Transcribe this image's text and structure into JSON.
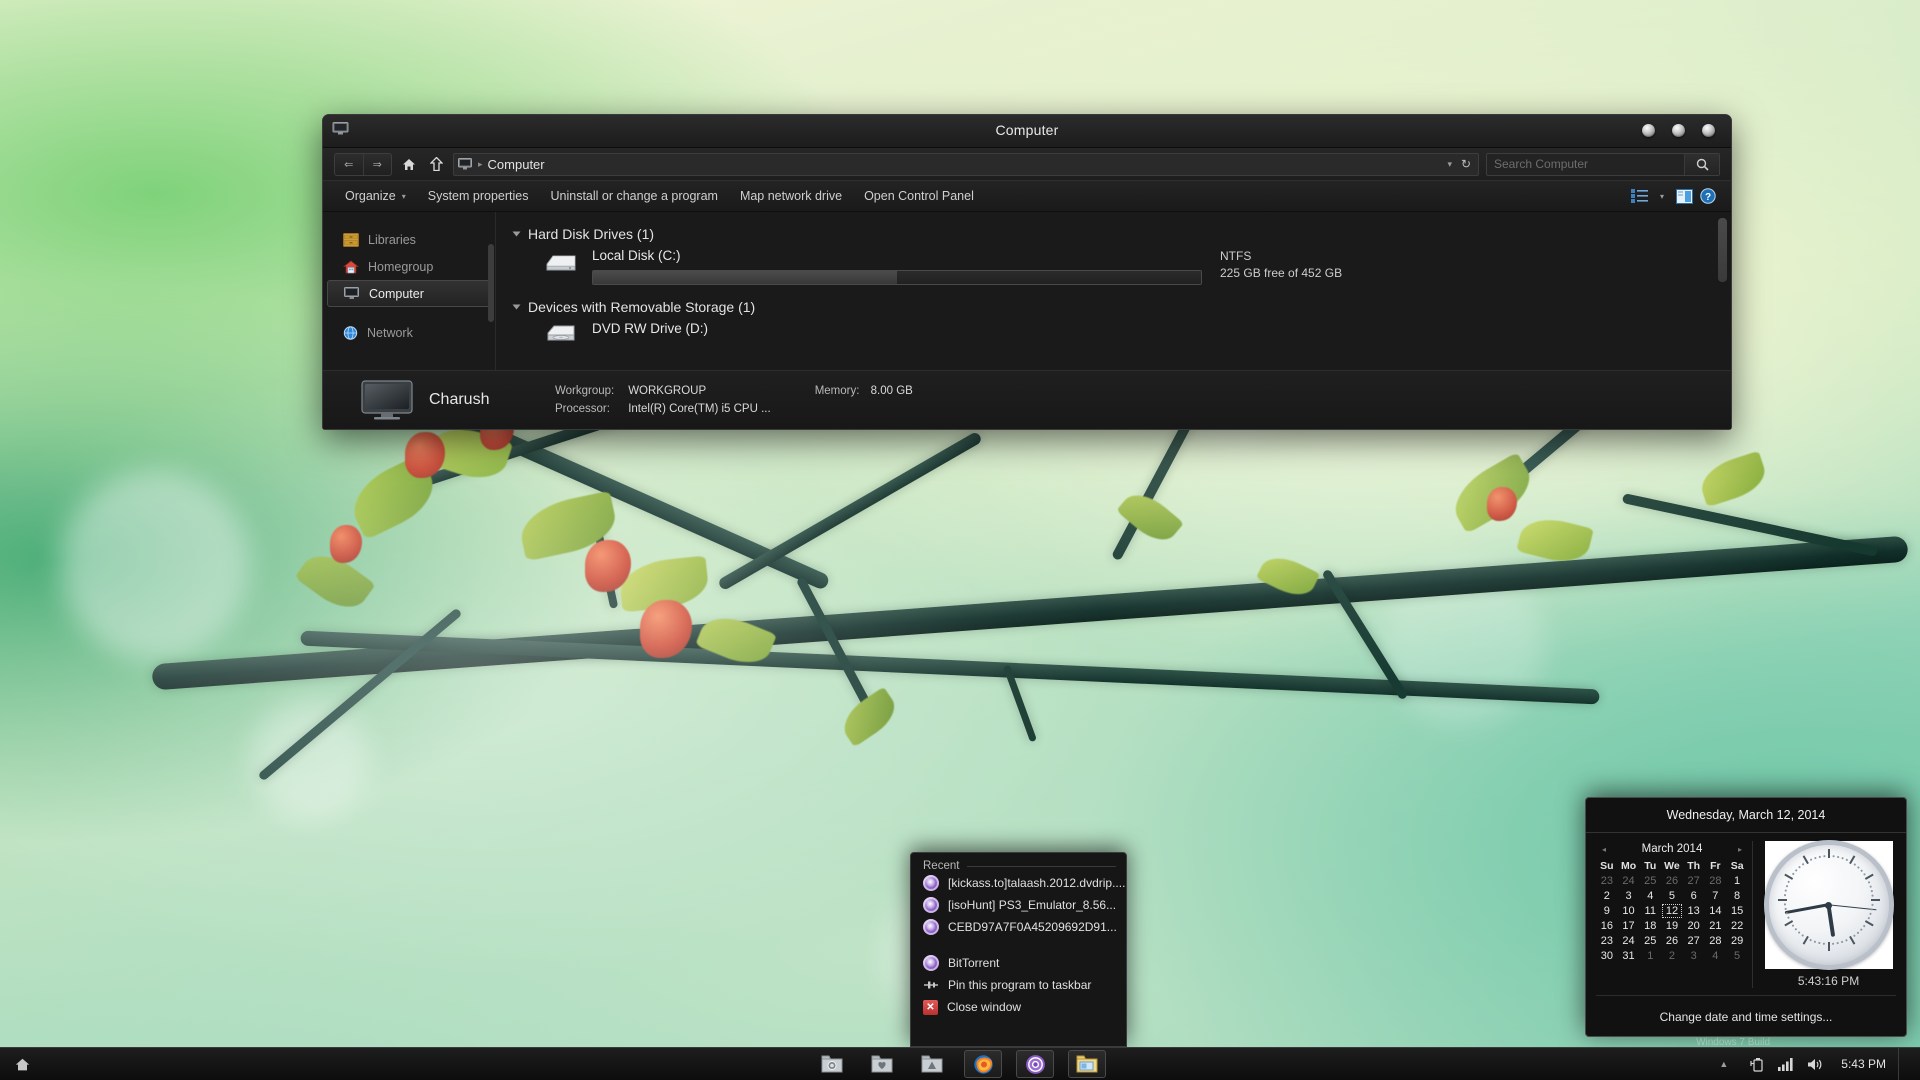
{
  "wallpaper": {
    "description": "blossoming thorn branch on pale green bokeh background"
  },
  "explorer": {
    "title": "Computer",
    "window_controls": [
      "minimize",
      "maximize",
      "close"
    ],
    "nav": {
      "back_icon": "chevron-left-icon",
      "forward_icon": "chevron-right-icon",
      "home_icon": "home-icon",
      "up_icon": "up-arrow-icon",
      "breadcrumb": "Computer",
      "breadcrumb_separator": "▸",
      "dropdown_caret": "▾",
      "refresh_icon": "↻"
    },
    "search": {
      "placeholder": "Search Computer",
      "value": "",
      "button_icon": "search-icon"
    },
    "commands": [
      {
        "label": "Organize",
        "has_caret": true
      },
      {
        "label": "System properties",
        "has_caret": false
      },
      {
        "label": "Uninstall or change a program",
        "has_caret": false
      },
      {
        "label": "Map network drive",
        "has_caret": false
      },
      {
        "label": "Open Control Panel",
        "has_caret": false
      }
    ],
    "command_right": {
      "view_icon": "list-view-icon",
      "view_caret": "▾",
      "preview_icon": "preview-pane-icon",
      "help_icon": "help-icon"
    },
    "sidebar": [
      {
        "label": "Libraries",
        "icon": "libraries-icon",
        "selected": false
      },
      {
        "label": "Homegroup",
        "icon": "homegroup-icon",
        "selected": false
      },
      {
        "label": "Computer",
        "icon": "computer-icon",
        "selected": true
      },
      {
        "label": "Network",
        "icon": "network-icon",
        "selected": false
      }
    ],
    "groups": [
      {
        "label": "Hard Disk Drives (1)",
        "drives": [
          {
            "name": "Local Disk (C:)",
            "icon": "hard-drive-icon",
            "filesystem": "NTFS",
            "space_text": "225 GB free of 452 GB",
            "used_percent": 50
          }
        ]
      },
      {
        "label": "Devices with Removable Storage (1)",
        "drives": [
          {
            "name": "DVD RW Drive (D:)",
            "icon": "optical-drive-icon",
            "filesystem": "",
            "space_text": "",
            "used_percent": 0
          }
        ]
      }
    ],
    "details": {
      "computer_name": "Charush",
      "icon": "monitor-icon",
      "fields": [
        {
          "key": "Workgroup:",
          "value": "WORKGROUP"
        },
        {
          "key": "Processor:",
          "value": "Intel(R) Core(TM) i5 CPU  ..."
        },
        {
          "key": "Memory:",
          "value": "8.00 GB"
        }
      ]
    }
  },
  "jumplist": {
    "header": "Recent",
    "recent": [
      {
        "label": "[kickass.to]talaash.2012.dvdrip....",
        "icon": "bittorrent-icon"
      },
      {
        "label": "[isoHunt] PS3_Emulator_8.56...",
        "icon": "bittorrent-icon"
      },
      {
        "label": "CEBD97A7F0A45209692D91...",
        "icon": "bittorrent-icon"
      }
    ],
    "actions": [
      {
        "label": "BitTorrent",
        "icon": "bittorrent-icon"
      },
      {
        "label": "Pin this program to taskbar",
        "icon": "pin-icon"
      },
      {
        "label": "Close window",
        "icon": "close-window-icon"
      }
    ]
  },
  "clock_flyout": {
    "header": "Wednesday, March 12, 2014",
    "calendar": {
      "month_title": "March 2014",
      "prev_arrow": "◂",
      "next_arrow": "▸",
      "weekdays": [
        "Su",
        "Mo",
        "Tu",
        "We",
        "Th",
        "Fr",
        "Sa"
      ],
      "weeks": [
        [
          {
            "d": "23",
            "mute": true
          },
          {
            "d": "24",
            "mute": true
          },
          {
            "d": "25",
            "mute": true
          },
          {
            "d": "26",
            "mute": true
          },
          {
            "d": "27",
            "mute": true
          },
          {
            "d": "28",
            "mute": true
          },
          {
            "d": "1",
            "mute": false
          }
        ],
        [
          {
            "d": "2",
            "mute": false
          },
          {
            "d": "3",
            "mute": false
          },
          {
            "d": "4",
            "mute": false
          },
          {
            "d": "5",
            "mute": false
          },
          {
            "d": "6",
            "mute": false
          },
          {
            "d": "7",
            "mute": false
          },
          {
            "d": "8",
            "mute": false
          }
        ],
        [
          {
            "d": "9",
            "mute": false
          },
          {
            "d": "10",
            "mute": false
          },
          {
            "d": "11",
            "mute": false
          },
          {
            "d": "12",
            "mute": false,
            "today": true
          },
          {
            "d": "13",
            "mute": false
          },
          {
            "d": "14",
            "mute": false
          },
          {
            "d": "15",
            "mute": false
          }
        ],
        [
          {
            "d": "16",
            "mute": false
          },
          {
            "d": "17",
            "mute": false
          },
          {
            "d": "18",
            "mute": false
          },
          {
            "d": "19",
            "mute": false
          },
          {
            "d": "20",
            "mute": false
          },
          {
            "d": "21",
            "mute": false
          },
          {
            "d": "22",
            "mute": false
          }
        ],
        [
          {
            "d": "23",
            "mute": false
          },
          {
            "d": "24",
            "mute": false
          },
          {
            "d": "25",
            "mute": false
          },
          {
            "d": "26",
            "mute": false
          },
          {
            "d": "27",
            "mute": false
          },
          {
            "d": "28",
            "mute": false
          },
          {
            "d": "29",
            "mute": false
          }
        ],
        [
          {
            "d": "30",
            "mute": false
          },
          {
            "d": "31",
            "mute": false
          },
          {
            "d": "1",
            "mute": true
          },
          {
            "d": "2",
            "mute": true
          },
          {
            "d": "3",
            "mute": true
          },
          {
            "d": "4",
            "mute": true
          },
          {
            "d": "5",
            "mute": true
          }
        ]
      ]
    },
    "clock": {
      "time_text": "5:43:16 PM",
      "hour": 5,
      "minute": 43,
      "second": 16
    },
    "footer_link": "Change date and time settings..."
  },
  "taskbar": {
    "start_icon": "start-home-icon",
    "items": [
      {
        "icon": "folder-camera-icon",
        "active": false
      },
      {
        "icon": "folder-heart-icon",
        "active": false
      },
      {
        "icon": "folder-apps-icon",
        "active": false
      },
      {
        "icon": "firefox-icon",
        "active": true
      },
      {
        "icon": "bittorrent-icon",
        "active": true
      },
      {
        "icon": "explorer-folder-icon",
        "active": true
      }
    ],
    "tray": {
      "overflow_arrow": "▲",
      "icons": [
        "battery-icon",
        "network-signal-icon",
        "volume-icon"
      ],
      "time": "5:43 PM"
    },
    "watermark": "Windows 7 Build"
  },
  "colors": {
    "window_bg": "#1a1a1a",
    "accent_blue": "#2f7fc1",
    "text_primary": "#e6e6e6",
    "text_muted": "#9a9a9a"
  }
}
